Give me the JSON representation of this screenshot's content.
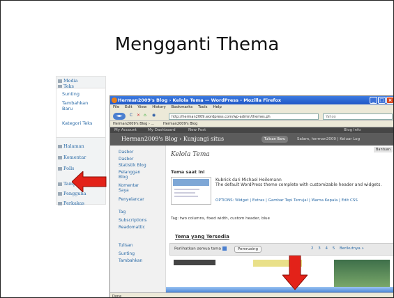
{
  "slide": {
    "title": "Mengganti Thema"
  },
  "left_menu": {
    "items": [
      {
        "label": "Media"
      },
      {
        "label": "Teks"
      },
      {
        "label": "Halaman"
      },
      {
        "label": "Komentar"
      },
      {
        "label": "Polls"
      },
      {
        "label": "Tampilan"
      },
      {
        "label": "Pengguna"
      },
      {
        "label": "Perkakas"
      }
    ],
    "sub": [
      "Sunting",
      "Tambahkan Baru",
      "Kategori Teks"
    ]
  },
  "browser": {
    "window_title": "Herman2009's Blog › Kelola Tema — WordPress - Mozilla Firefox",
    "menu": [
      "File",
      "Edit",
      "View",
      "History",
      "Bookmarks",
      "Tools",
      "Help"
    ],
    "url": "http://herman2009.wordpress.com/wp-admin/themes.ph",
    "search_placeholder": "Yahoo",
    "bookmarks": [
      "Herman2009's Blog › ...",
      "Herman2009's Blog"
    ],
    "status": "Done"
  },
  "wp": {
    "top_links": [
      "My Account",
      "My Dashboard",
      "New Post",
      "Blog Info"
    ],
    "blog_name": "Herman2009's Blog › Kunjungi situs",
    "visit_button": "Tulisan Baru",
    "greeting": "Salam, herman2009 | Keluar Log",
    "help": "Bantuan",
    "sidebar": [
      "Dasbor",
      "Dasbor",
      "Statistik Blog",
      "Pelanggan Blog",
      "Komentar Saya",
      "Penyelancar",
      "Tag",
      "Subscriptions",
      "Readomattic",
      "Tulisan",
      "Sunting",
      "Tambahkan"
    ],
    "page_title": "Kelola Tema",
    "current_heading": "Tema saat ini",
    "current_theme": "Kubrick dari Michael Heilemann",
    "current_desc": "The default WordPress theme complete with customizable header and widgets.",
    "options": "OPTIONS: Widget | Extras | Gambar Tepi Terrujal | Warna Kepala | Edit CSS",
    "tags": "Tag: two columns, fixed width, custom header, blue",
    "available_heading": "Tema yang Tersedia",
    "filter_label": "Perlihatkan semua tema",
    "random_button": "Pemrusing",
    "pages": [
      "2",
      "3",
      "4",
      "5",
      "Berikutnya »"
    ]
  },
  "colors": {
    "arrow": "#e32219",
    "accent": "#2a6aa6"
  }
}
